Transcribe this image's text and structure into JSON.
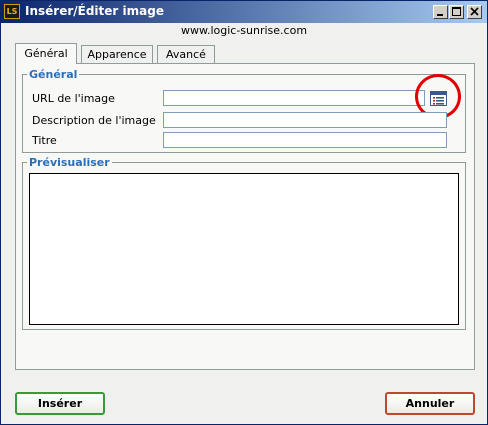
{
  "window": {
    "title": "Insérer/Éditer image",
    "logo_text": "LS",
    "controls": {
      "minimize_icon": "minimize-icon",
      "maximize_icon": "maximize-icon",
      "close_icon": "close-icon"
    }
  },
  "url_bar": {
    "text": "www.logic-sunrise.com"
  },
  "tabs": [
    {
      "label": "Général",
      "active": true
    },
    {
      "label": "Apparence",
      "active": false
    },
    {
      "label": "Avancé",
      "active": false
    }
  ],
  "general": {
    "legend": "Général",
    "fields": {
      "image_url": {
        "label": "URL de l'image",
        "value": ""
      },
      "image_description": {
        "label": "Description de l'image",
        "value": ""
      },
      "title": {
        "label": "Titre",
        "value": ""
      }
    },
    "browse_icon": "image-browser-icon"
  },
  "preview": {
    "legend": "Prévisualiser"
  },
  "actions": {
    "insert_label": "Insérer",
    "cancel_label": "Annuler"
  },
  "colors": {
    "titlebar_start": "#0a246a",
    "titlebar_end": "#a6caf0",
    "legend_text": "#2b6fb6",
    "highlight_circle": "#e00000",
    "insert_border": "#3a9a3a",
    "cancel_border": "#c0472a"
  }
}
